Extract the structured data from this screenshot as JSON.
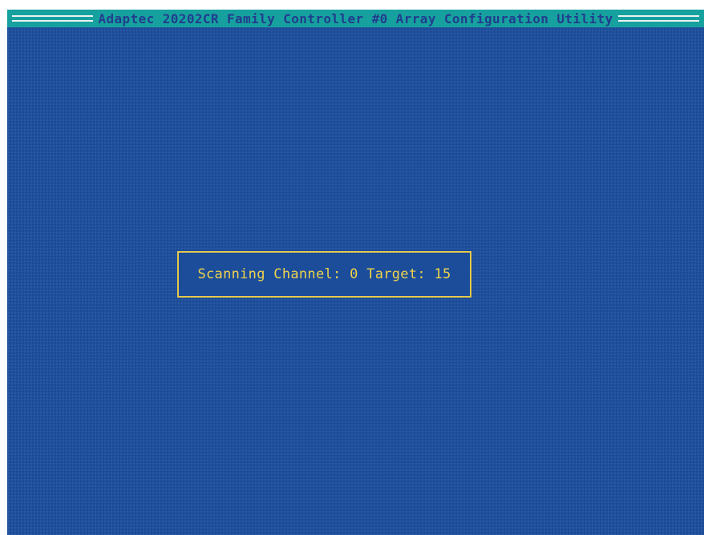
{
  "window": {
    "title": "Adaptec 20202CR Family Controller #0 Array Configuration Utility"
  },
  "status_dialog": {
    "message": "Scanning Channel: 0 Target: 15"
  },
  "colors": {
    "background": "#1d4f9d",
    "title_bar": "#16a19f",
    "title_text": "#223c8e",
    "dialog_border": "#e6c94c",
    "dialog_text": "#f0d34c"
  }
}
